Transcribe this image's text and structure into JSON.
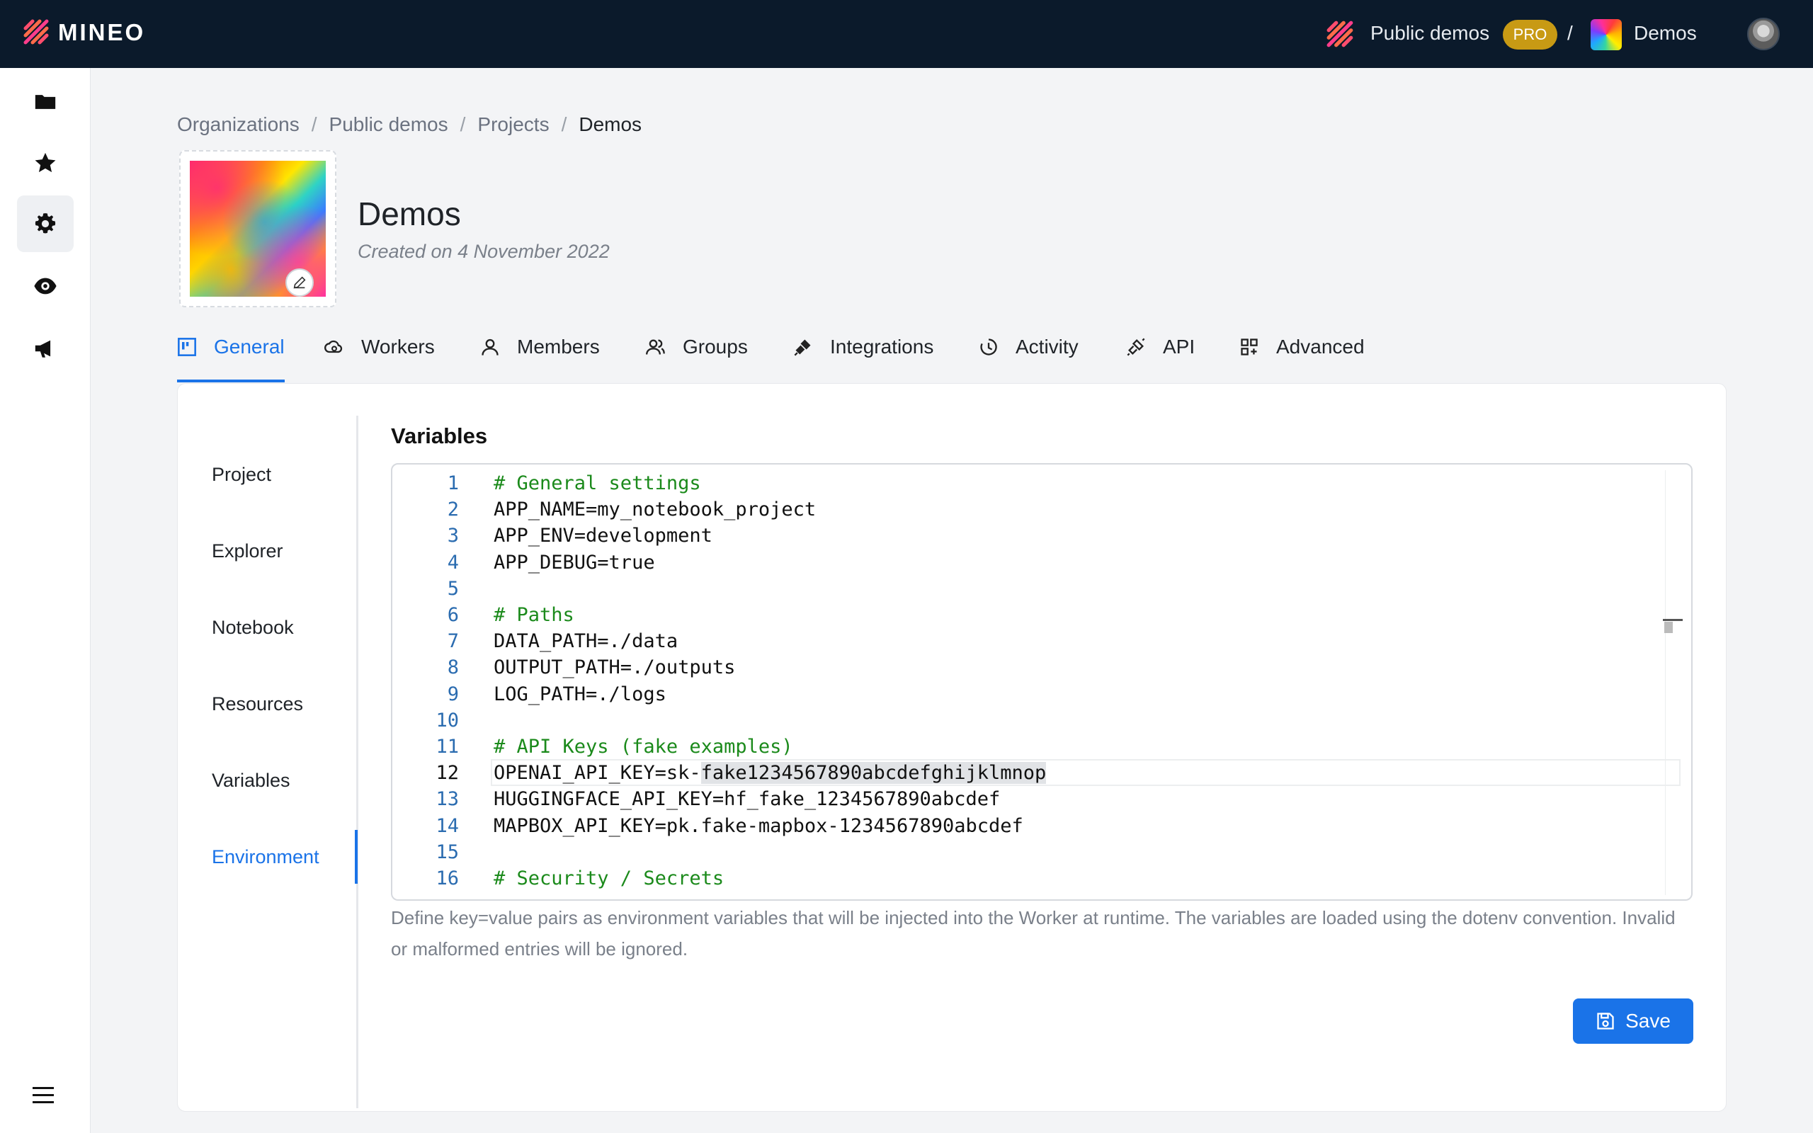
{
  "brand": {
    "name": "MINEO"
  },
  "topbar": {
    "org_name": "Public demos",
    "plan_badge": "PRO",
    "separator": "/",
    "project_name": "Demos"
  },
  "breadcrumb": {
    "items": [
      "Organizations",
      "Public demos",
      "Projects",
      "Demos"
    ],
    "separator": "/"
  },
  "project": {
    "title": "Demos",
    "created": "Created on 4 November 2022"
  },
  "tabs": [
    {
      "label": "General",
      "icon": "board-icon",
      "active": true
    },
    {
      "label": "Workers",
      "icon": "cloud-cog-icon"
    },
    {
      "label": "Members",
      "icon": "user-icon"
    },
    {
      "label": "Groups",
      "icon": "users-icon"
    },
    {
      "label": "Integrations",
      "icon": "plug-icon"
    },
    {
      "label": "Activity",
      "icon": "history-icon"
    },
    {
      "label": "API",
      "icon": "api-icon"
    },
    {
      "label": "Advanced",
      "icon": "apps-icon"
    }
  ],
  "subnav": {
    "items": [
      "Project",
      "Explorer",
      "Notebook",
      "Resources",
      "Variables",
      "Environment"
    ],
    "active": "Environment"
  },
  "section": {
    "title": "Variables"
  },
  "editor": {
    "current_line": 12,
    "lines": [
      {
        "n": "1",
        "text": "# General settings",
        "comment": true
      },
      {
        "n": "2",
        "text": "APP_NAME=my_notebook_project"
      },
      {
        "n": "3",
        "text": "APP_ENV=development"
      },
      {
        "n": "4",
        "text": "APP_DEBUG=true"
      },
      {
        "n": "5",
        "text": ""
      },
      {
        "n": "6",
        "text": "# Paths",
        "comment": true
      },
      {
        "n": "7",
        "text": "DATA_PATH=./data"
      },
      {
        "n": "8",
        "text": "OUTPUT_PATH=./outputs"
      },
      {
        "n": "9",
        "text": "LOG_PATH=./logs"
      },
      {
        "n": "10",
        "text": ""
      },
      {
        "n": "11",
        "text": "# API Keys (fake examples)",
        "comment": true
      },
      {
        "n": "12",
        "text_prefix": "OPENAI_API_KEY=sk-",
        "text_selected": "fake1234567890abcdefghijklmnop"
      },
      {
        "n": "13",
        "text": "HUGGINGFACE_API_KEY=hf_fake_1234567890abcdef"
      },
      {
        "n": "14",
        "text": "MAPBOX_API_KEY=pk.fake-mapbox-1234567890abcdef"
      },
      {
        "n": "15",
        "text": ""
      },
      {
        "n": "16",
        "text": "# Security / Secrets",
        "comment": true
      }
    ]
  },
  "help_text": "Define key=value pairs as environment variables that will be injected into the Worker at runtime. The variables are loaded using the dotenv convention. Invalid or malformed entries will be ignored.",
  "actions": {
    "save_label": "Save"
  },
  "colors": {
    "accent": "#1a73e8",
    "topbar_bg": "#0b1a2b",
    "pro_badge": "#c89a14",
    "comment": "#1b8a1b"
  }
}
